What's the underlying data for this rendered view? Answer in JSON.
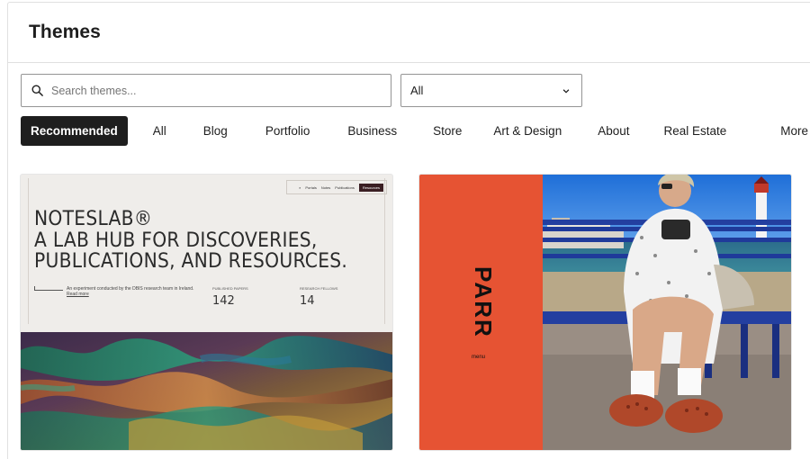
{
  "header": {
    "title": "Themes"
  },
  "search": {
    "placeholder": "Search themes..."
  },
  "filter": {
    "selected": "All"
  },
  "tabs": [
    {
      "label": "Recommended",
      "active": true
    },
    {
      "label": "All"
    },
    {
      "label": "Blog"
    },
    {
      "label": "Portfolio"
    },
    {
      "label": "Business"
    },
    {
      "label": "Store"
    },
    {
      "label": "Art & Design"
    },
    {
      "label": "About"
    },
    {
      "label": "Real Estate"
    },
    {
      "label": "More"
    }
  ],
  "cards": {
    "noteslab": {
      "nav_items": [
        "Portals",
        "Notes",
        "Publications"
      ],
      "nav_button": "Resources",
      "title_lines": [
        "NOTESLAB®",
        "A LAB HUB FOR DISCOVERIES,",
        "PUBLICATIONS, AND RESOURCES."
      ],
      "intro_text": "An experiment conducted by the DBIS research team in Ireland.",
      "intro_link": "Read more",
      "stat1_label": "PUBLISHED PAPERS",
      "stat1_value": "142",
      "stat2_label": "RESEARCH FELLOWS",
      "stat2_value": "14"
    },
    "parr": {
      "word": "PARR",
      "menu": "menu"
    }
  },
  "colors": {
    "accent_dark": "#1e1e1e",
    "parr_orange": "#e65333",
    "noteslab_bg": "#efedea"
  },
  "icons": {
    "search": "search-icon",
    "chevron": "chevron-down-icon"
  }
}
